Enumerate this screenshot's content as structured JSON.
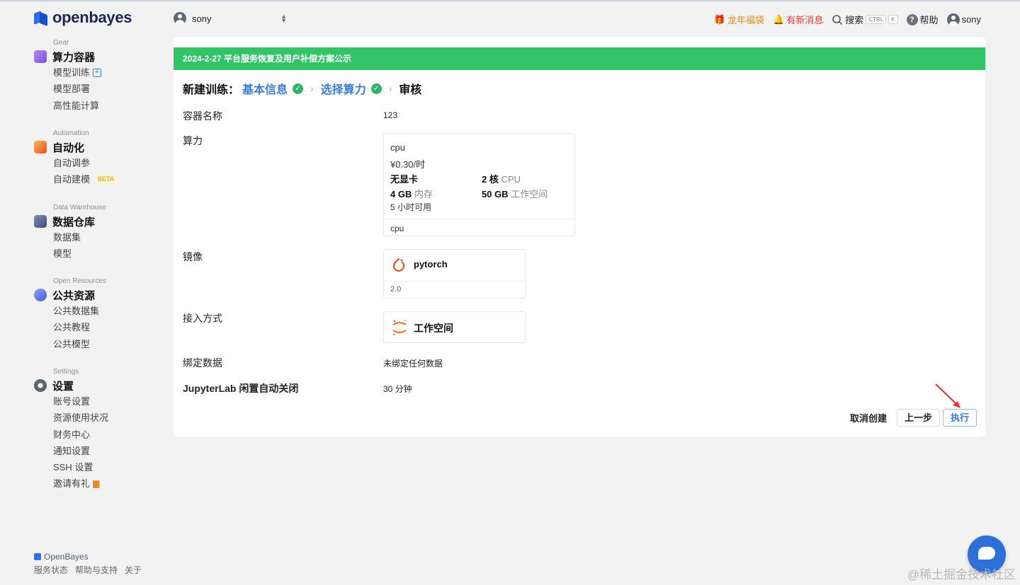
{
  "brand": {
    "name": "openbayes"
  },
  "sidebar": {
    "sections": [
      {
        "category": "Gear",
        "title": "算力容器",
        "items": [
          "模型训练",
          "模型部署",
          "高性能计算"
        ]
      },
      {
        "category": "Automation",
        "title": "自动化",
        "items": [
          "自动调参",
          "自动建模"
        ]
      },
      {
        "category": "Data Warehouse",
        "title": "数据仓库",
        "items": [
          "数据集",
          "模型"
        ]
      },
      {
        "category": "Open Resources",
        "title": "公共资源",
        "items": [
          "公共数据集",
          "公共教程",
          "公共模型"
        ]
      },
      {
        "category": "Settings",
        "title": "设置",
        "items": [
          "账号设置",
          "资源使用状况",
          "财务中心",
          "通知设置",
          "SSH 设置",
          "邀请有礼"
        ]
      }
    ],
    "beta_badge": "BETA",
    "footer_brand": "OpenBayes",
    "footer_links": [
      "服务状态",
      "帮助与支持",
      "关于"
    ]
  },
  "topbar": {
    "workspace_user": "sony",
    "gift": "龙年福袋",
    "messages": "有新消息",
    "search": "搜索",
    "kbd_ctrl": "CTRL",
    "kbd_k": "K",
    "help": "帮助",
    "user": "sony"
  },
  "banner": "2024-2-27 平台服务恢复及用户补偿方案公示",
  "steps": {
    "prefix": "新建训练：",
    "step1": "基本信息",
    "step2": "选择算力",
    "step3": "审核"
  },
  "form": {
    "name_label": "容器名称",
    "name_value": "123",
    "compute_label": "算力",
    "compute": {
      "title": "cpu",
      "price": "¥0.30/时",
      "gpu": "无显卡",
      "cores_num": "2 核",
      "cores_unit": "CPU",
      "mem_num": "4 GB",
      "mem_unit": "内存",
      "ws_num": "50 GB",
      "ws_unit": "工作空间",
      "available": "5 小时可用",
      "footer": "cpu"
    },
    "image_label": "镜像",
    "image": {
      "name": "pytorch",
      "version": "2.0"
    },
    "access_label": "接入方式",
    "access": {
      "name": "工作空间"
    },
    "binding_label": "绑定数据",
    "binding_value": "未绑定任何数据",
    "idle_label": "JupyterLab 闲置自动关闭",
    "idle_value": "30 分钟"
  },
  "actions": {
    "cancel": "取消创建",
    "prev": "上一步",
    "execute": "执行"
  },
  "watermark": "@稀土掘金技术社区",
  "colors": {
    "banner_green": "#33c46a",
    "link_blue": "#3a7bd5",
    "check_green": "#2fb56a",
    "gift_orange": "#e38a1c",
    "bell_red": "#e4393c"
  }
}
